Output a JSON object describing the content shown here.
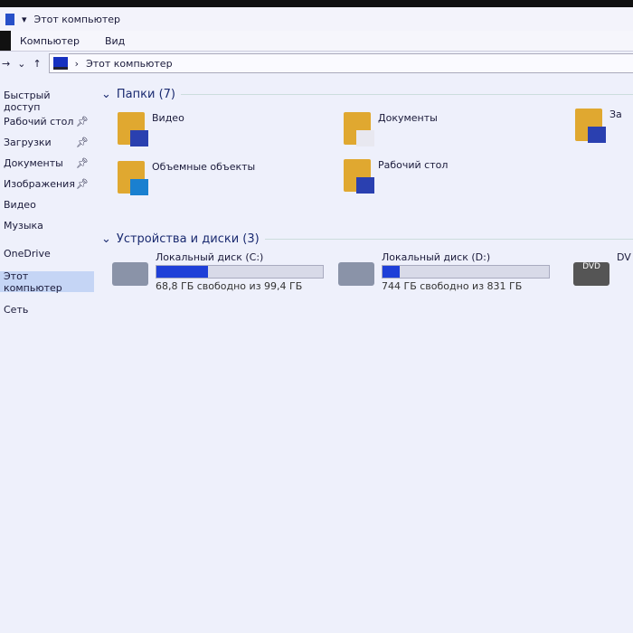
{
  "window": {
    "title": "Этот компьютер"
  },
  "ribbon": {
    "tabs": [
      "Компьютер",
      "Вид"
    ]
  },
  "address": {
    "path": "Этот компьютер"
  },
  "sidebar": {
    "items": [
      {
        "label": "Быстрый доступ",
        "pinned": false
      },
      {
        "label": "Рабочий стол",
        "pinned": true
      },
      {
        "label": "Загрузки",
        "pinned": true
      },
      {
        "label": "Документы",
        "pinned": true
      },
      {
        "label": "Изображения",
        "pinned": true
      },
      {
        "label": "Видео",
        "pinned": false
      },
      {
        "label": "Музыка",
        "pinned": false
      },
      {
        "label": "OneDrive",
        "pinned": false
      },
      {
        "label": "Этот компьютер",
        "pinned": false,
        "selected": true
      },
      {
        "label": "Сеть",
        "pinned": false
      }
    ]
  },
  "folders": {
    "header": "Папки (7)",
    "items": [
      "Видео",
      "Документы",
      "За",
      "Объемные объекты",
      "Рабочий стол"
    ]
  },
  "devices": {
    "header": "Устройства и диски (3)",
    "items": [
      {
        "name": "Локальный диск (C:)",
        "info": "68,8 ГБ свободно из 99,4 ГБ",
        "used_fraction": 0.31
      },
      {
        "name": "Локальный диск (D:)",
        "info": "744 ГБ свободно из 831 ГБ",
        "used_fraction": 0.105
      },
      {
        "name": "DV",
        "badge": "DVD"
      }
    ]
  }
}
